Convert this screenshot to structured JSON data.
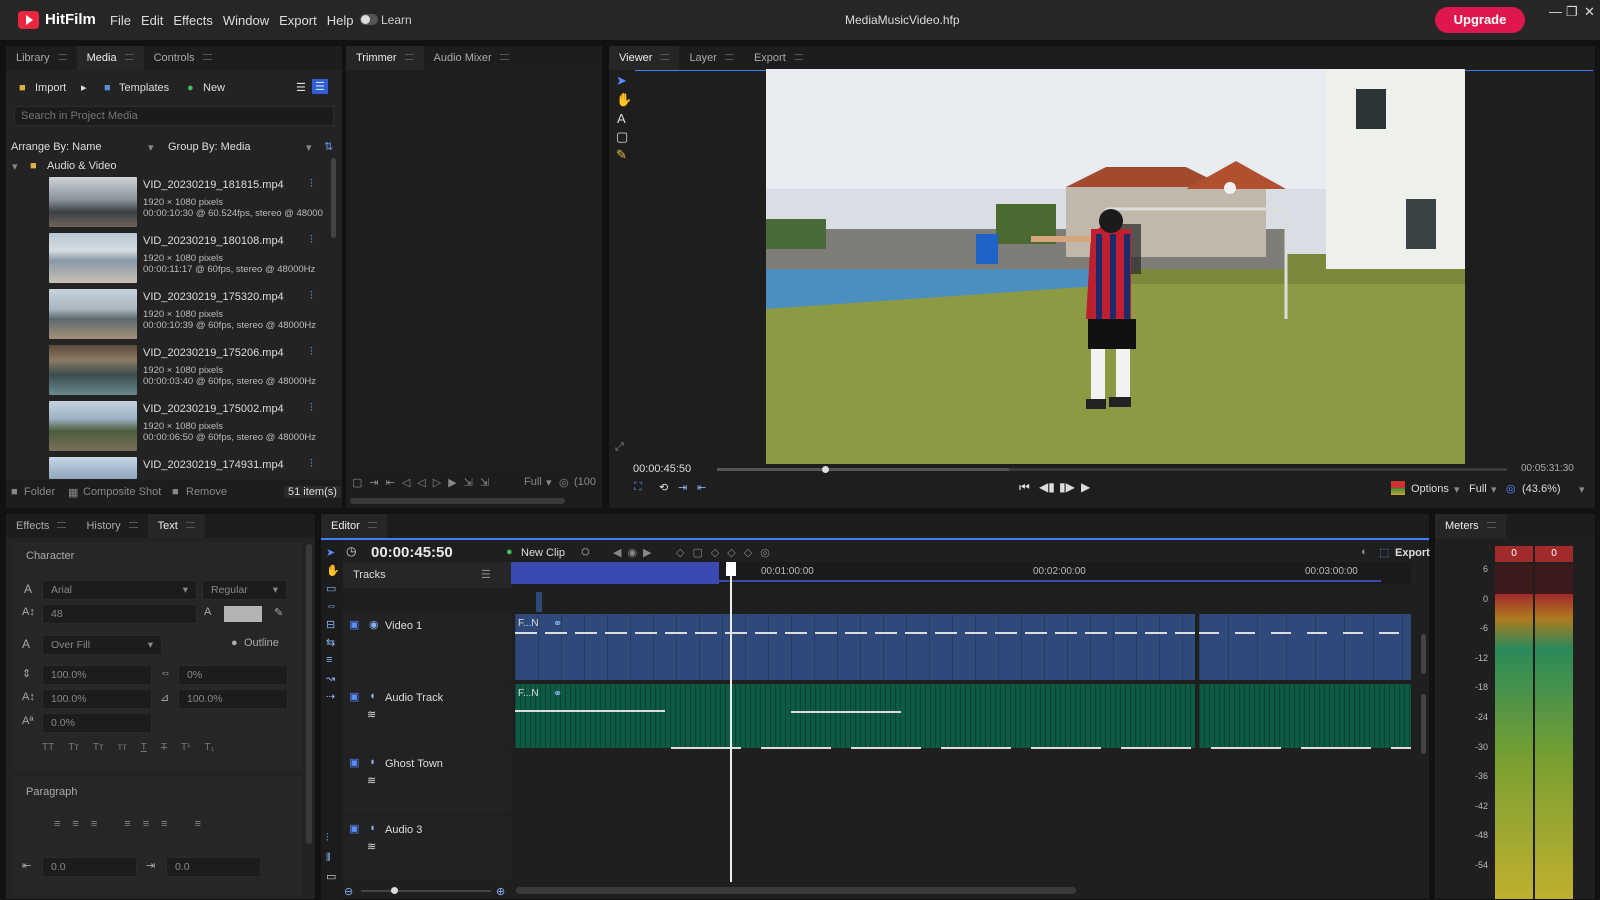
{
  "app": {
    "name": "HitFilm",
    "project": "MediaMusicVideo.hfp",
    "learn": "Learn",
    "upgrade": "Upgrade",
    "menu": [
      "File",
      "Edit",
      "Effects",
      "Window",
      "Export",
      "Help"
    ]
  },
  "media_panel": {
    "tabs": [
      "Library",
      "Media",
      "Controls"
    ],
    "import": "Import",
    "templates": "Templates",
    "new": "New",
    "search_placeholder": "Search in Project Media",
    "arrange": "Arrange By: Name",
    "group": "Group By: Media",
    "folder": "Audio & Video",
    "items": [
      {
        "name": "VID_20230219_181815.mp4",
        "res": "1920 × 1080 pixels",
        "meta": "00:00:10:30 @ 60.524fps, stereo @ 48000"
      },
      {
        "name": "VID_20230219_180108.mp4",
        "res": "1920 × 1080 pixels",
        "meta": "00:00:11:17 @ 60fps, stereo @ 48000Hz"
      },
      {
        "name": "VID_20230219_175320.mp4",
        "res": "1920 × 1080 pixels",
        "meta": "00:00:10:39 @ 60fps, stereo @ 48000Hz"
      },
      {
        "name": "VID_20230219_175206.mp4",
        "res": "1920 × 1080 pixels",
        "meta": "00:00:03:40 @ 60fps, stereo @ 48000Hz"
      },
      {
        "name": "VID_20230219_175002.mp4",
        "res": "1920 × 1080 pixels",
        "meta": "00:00:06:50 @ 60fps, stereo @ 48000Hz"
      },
      {
        "name": "VID_20230219_174931.mp4",
        "res": "",
        "meta": ""
      }
    ],
    "footer": {
      "folder": "Folder",
      "composite": "Composite Shot",
      "remove": "Remove",
      "count": "51 item(s)"
    }
  },
  "trimmer": {
    "tabs": [
      "Trimmer",
      "Audio Mixer"
    ],
    "full": "Full",
    "zoom": "(100"
  },
  "viewer": {
    "tabs": [
      "Viewer",
      "Layer",
      "Export"
    ],
    "current_time": "00:00:45:50",
    "duration": "00:05:31:30",
    "options": "Options",
    "full": "Full",
    "zoom": "(43.6%)",
    "playhead_fraction": 0.137
  },
  "effects_panel": {
    "tabs": [
      "Effects",
      "History",
      "Text"
    ],
    "character": "Character",
    "font": "Arial",
    "style": "Regular",
    "size": "48",
    "fill": "Over Fill",
    "outline": "Outline",
    "scale_v": "100.0%",
    "tracking": "0%",
    "scale_h": "100.0%",
    "skew": "100.0%",
    "baseline": "0.0%",
    "format_glyphs": [
      "TT",
      "Tт",
      "Tт",
      "тт",
      "T",
      "T",
      "T¹",
      "T₁"
    ],
    "paragraph": "Paragraph",
    "indent_left": "0.0",
    "indent_right": "0.0"
  },
  "editor": {
    "tab": "Editor",
    "time": "00:00:45:50",
    "new_clip": "New Clip",
    "export": "Export",
    "tracks_label": "Tracks",
    "ruler": [
      "00:01:00:00",
      "00:02:00:00",
      "00:03:00:00"
    ],
    "tracks": [
      {
        "name": "Video 1",
        "clip": "F...N",
        "type": "video"
      },
      {
        "name": "Audio Track",
        "clip": "F...N",
        "type": "audio"
      },
      {
        "name": "Ghost Town",
        "type": "audio"
      },
      {
        "name": "Audio 3",
        "type": "audio"
      }
    ]
  },
  "meters": {
    "tab": "Meters",
    "peak_left": "0",
    "peak_right": "0",
    "scale": [
      "6",
      "0",
      "-6",
      "-12",
      "-18",
      "-24",
      "-30",
      "-36",
      "-42",
      "-48",
      "-54"
    ]
  },
  "colors": {
    "accent": "#3d7fff",
    "video_clip": "#2f4a7a",
    "audio_clip": "#0d5a45",
    "upgrade": "#e0174e"
  }
}
